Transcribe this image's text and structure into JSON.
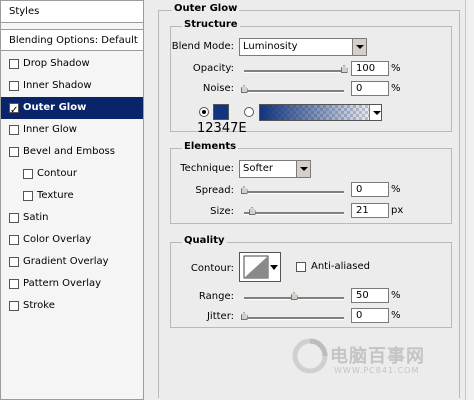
{
  "sidebar": {
    "styles_label": "Styles",
    "blending_label": "Blending Options: Default",
    "items": [
      {
        "label": "Drop Shadow",
        "checked": false
      },
      {
        "label": "Inner Shadow",
        "checked": false
      },
      {
        "label": "Outer Glow",
        "checked": true
      },
      {
        "label": "Inner Glow",
        "checked": false
      },
      {
        "label": "Bevel and Emboss",
        "checked": false
      },
      {
        "label": "Contour",
        "checked": false
      },
      {
        "label": "Texture",
        "checked": false
      },
      {
        "label": "Satin",
        "checked": false
      },
      {
        "label": "Color Overlay",
        "checked": false
      },
      {
        "label": "Gradient Overlay",
        "checked": false
      },
      {
        "label": "Pattern Overlay",
        "checked": false
      },
      {
        "label": "Stroke",
        "checked": false
      }
    ]
  },
  "panel": {
    "title": "Outer Glow",
    "structure": {
      "title": "Structure",
      "blend_mode_label": "Blend Mode:",
      "blend_mode_value": "Luminosity",
      "opacity_label": "Opacity:",
      "opacity_value": "100",
      "opacity_unit": "%",
      "opacity_level": 1.0,
      "noise_label": "Noise:",
      "noise_value": "0",
      "noise_unit": "%",
      "noise_level": 0.0,
      "color_hex": "#12347E",
      "color_caption": "12347E"
    },
    "elements": {
      "title": "Elements",
      "technique_label": "Technique:",
      "technique_value": "Softer",
      "spread_label": "Spread:",
      "spread_value": "0",
      "spread_unit": "%",
      "spread_level": 0.0,
      "size_label": "Size:",
      "size_value": "21",
      "size_unit": "px",
      "size_level": 0.08
    },
    "quality": {
      "title": "Quality",
      "contour_label": "Contour:",
      "anti_aliased_label": "Anti-aliased",
      "range_label": "Range:",
      "range_value": "50",
      "range_unit": "%",
      "range_level": 0.5,
      "jitter_label": "Jitter:",
      "jitter_value": "0",
      "jitter_unit": "%",
      "jitter_level": 0.0
    }
  },
  "watermark": {
    "brand": "电脑百事网",
    "url": "WWW.PC841.COM"
  }
}
